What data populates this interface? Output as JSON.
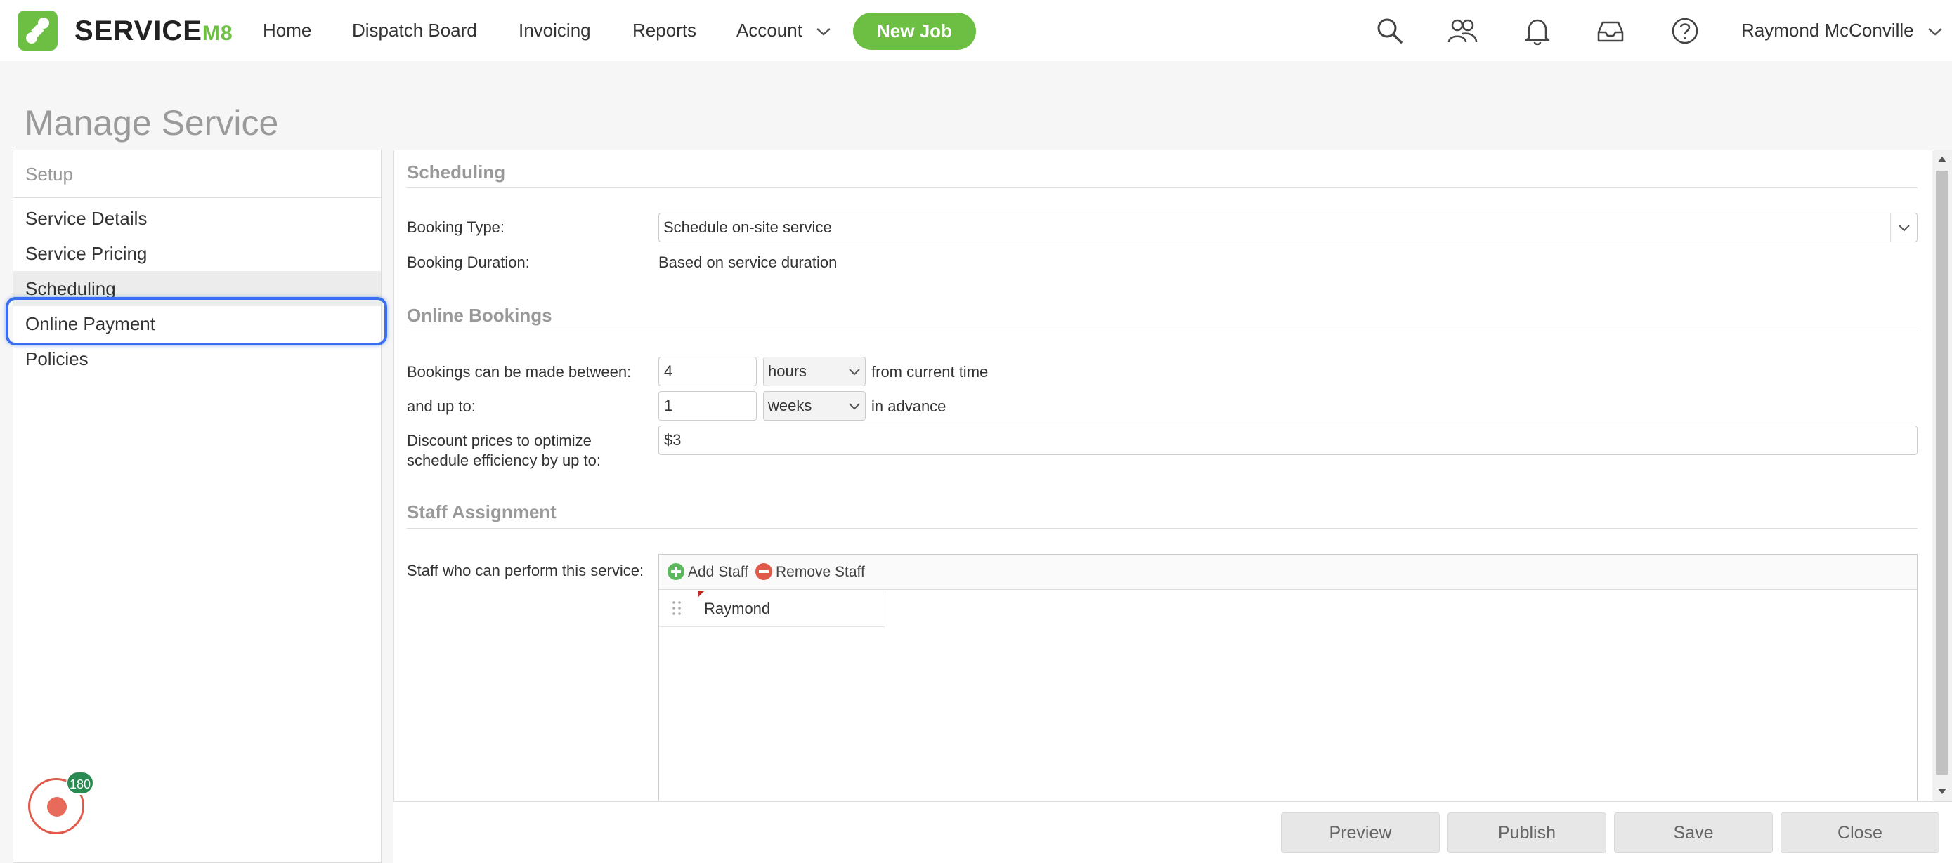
{
  "app": {
    "brand_name": "SERVICE",
    "brand_suffix": "M8",
    "brand_color": "#6cbf43"
  },
  "nav": {
    "items": [
      {
        "label": "Home"
      },
      {
        "label": "Dispatch Board"
      },
      {
        "label": "Invoicing"
      },
      {
        "label": "Reports"
      },
      {
        "label": "Account"
      }
    ],
    "new_job_label": "New Job",
    "icons": [
      "search-icon",
      "people-icon",
      "bell-icon",
      "inbox-icon",
      "help-icon"
    ],
    "user_name": "Raymond McConville"
  },
  "page": {
    "title": "Manage Service"
  },
  "setup": {
    "header": "Setup",
    "items": [
      {
        "label": "Service Details"
      },
      {
        "label": "Service Pricing"
      },
      {
        "label": "Scheduling"
      },
      {
        "label": "Online Payment"
      },
      {
        "label": "Policies"
      }
    ],
    "active_item": "Scheduling",
    "focused_item": "Online Payment"
  },
  "recorder": {
    "badge_count": "180"
  },
  "scheduling": {
    "title": "Scheduling",
    "booking_type_label": "Booking Type:",
    "booking_type_value": "Schedule on-site service",
    "booking_duration_label": "Booking Duration:",
    "booking_duration_value": "Based on service duration"
  },
  "online_bookings": {
    "title": "Online Bookings",
    "between_label": "Bookings can be made between:",
    "between_value": "4",
    "between_unit": "hours",
    "between_suffix": "from current time",
    "up_to_label": "and up to:",
    "up_to_value": "1",
    "up_to_unit": "weeks",
    "up_to_suffix": "in advance",
    "discount_label_line1": "Discount prices to optimize",
    "discount_label_line2": "schedule efficiency by up to:",
    "discount_value": "$3"
  },
  "staff": {
    "title": "Staff Assignment",
    "label": "Staff who can perform this service:",
    "add_label": "Add Staff",
    "remove_label": "Remove Staff",
    "members": [
      {
        "name": "Raymond"
      }
    ]
  },
  "footer": {
    "buttons": [
      {
        "label": "Preview"
      },
      {
        "label": "Publish"
      },
      {
        "label": "Save"
      },
      {
        "label": "Close"
      }
    ]
  }
}
